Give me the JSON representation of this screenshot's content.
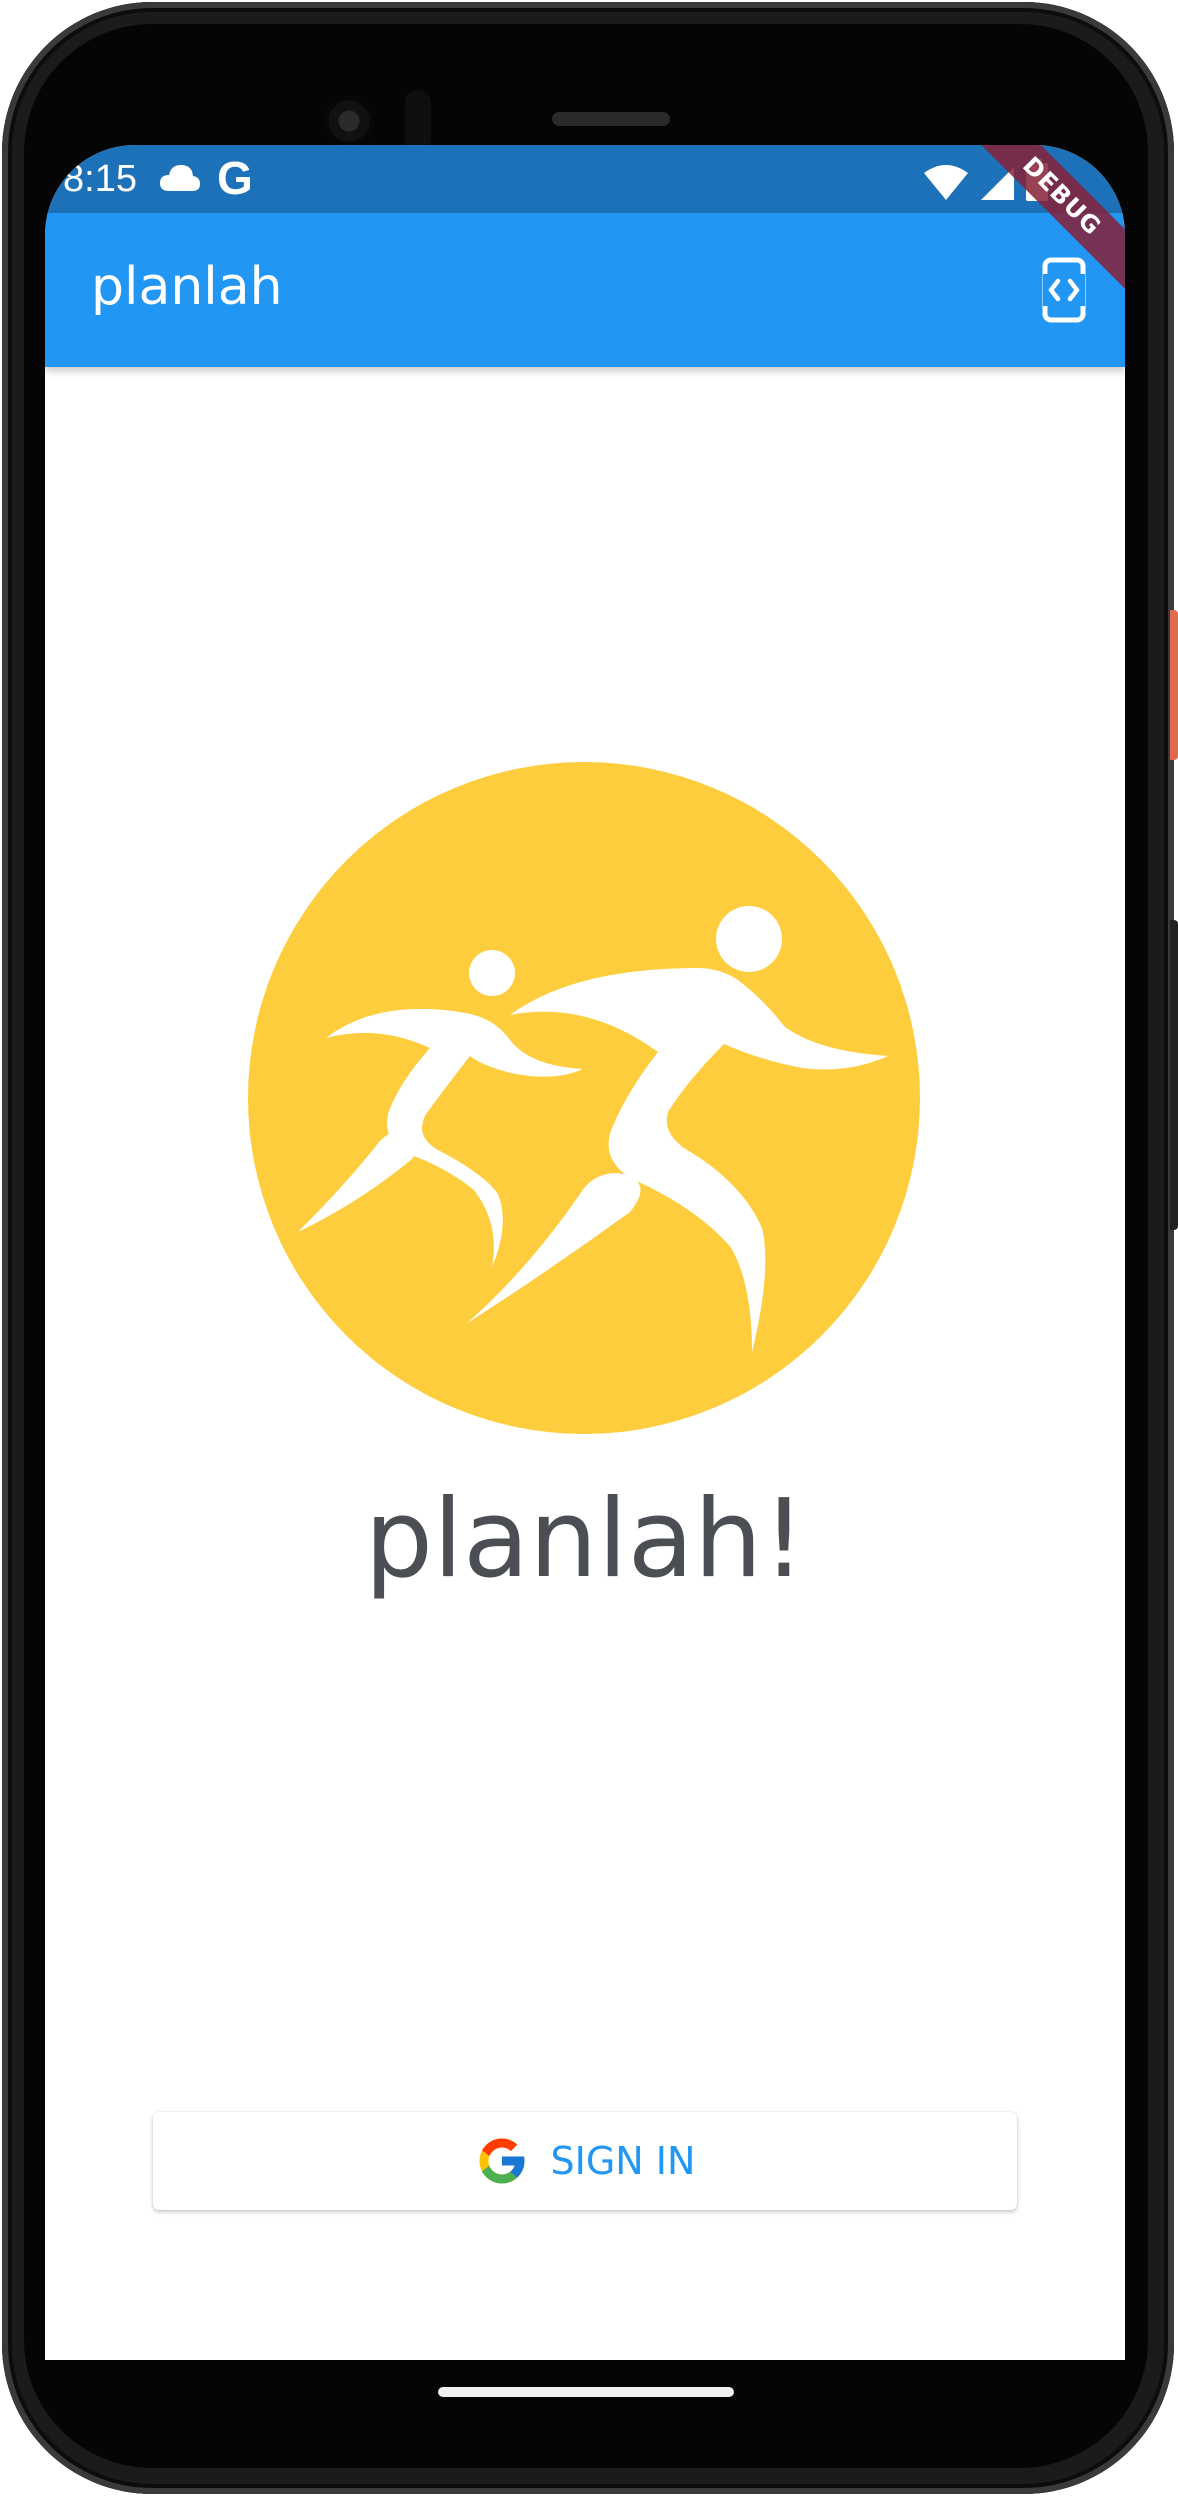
{
  "status_bar": {
    "time": "8:15",
    "google_glyph": "G",
    "icons": [
      "cloud-icon",
      "google-icon",
      "wifi-icon",
      "cell-signal-icon",
      "battery-icon"
    ],
    "color": "#1c71b9"
  },
  "app_bar": {
    "title": "planlah",
    "action_icon": "phone-code-icon",
    "color": "#2196f3"
  },
  "debug_banner": {
    "label": "DEBUG"
  },
  "main": {
    "logo_icon": "runners-logo-icon",
    "logo_color": "#fdcd3d",
    "brand_name": "planlah!"
  },
  "sign_in": {
    "icon": "google-g-icon",
    "label": "SIGN IN"
  }
}
